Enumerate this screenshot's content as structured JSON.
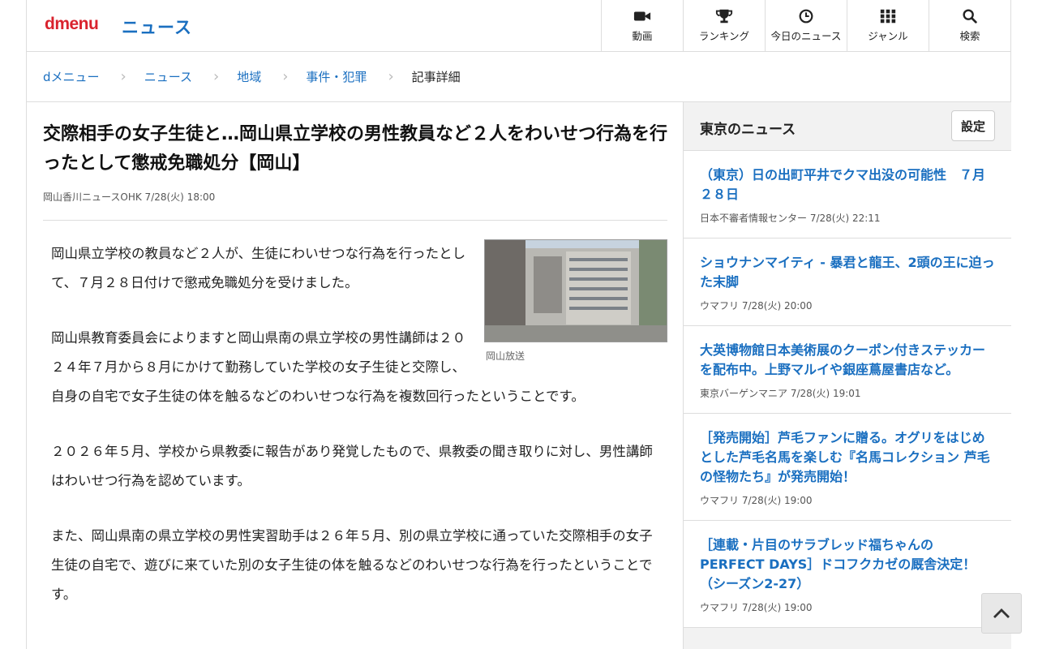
{
  "header": {
    "logo": "dmenu",
    "section": "ニュース",
    "nav": [
      {
        "label": "動画",
        "icon": "video-camera-icon"
      },
      {
        "label": "ランキング",
        "icon": "trophy-icon"
      },
      {
        "label": "今日のニュース",
        "icon": "clock-icon"
      },
      {
        "label": "ジャンル",
        "icon": "grid-icon"
      },
      {
        "label": "検索",
        "icon": "search-icon"
      }
    ]
  },
  "breadcrumb": [
    "dメニュー",
    "ニュース",
    "地域",
    "事件・犯罪",
    "記事詳細"
  ],
  "article": {
    "title": "交際相手の女子生徒と…岡山県立学校の男性教員など２人をわいせつ行為を行ったとして懲戒免職処分【岡山】",
    "meta": "岡山香川ニュースOHK 7/28(火) 18:00",
    "photo_caption": "岡山放送",
    "paragraphs": [
      "岡山県立学校の教員など２人が、生徒にわいせつな行為を行ったとして、７月２８日付けで懲戒免職処分を受けました。",
      "岡山県教育委員会によりますと岡山県南の県立学校の男性講師は２０２４年７月から８月にかけて勤務していた学校の女子生徒と交際し、自身の自宅で女子生徒の体を触るなどのわいせつな行為を複数回行ったということです。",
      "２０２６年５月、学校から県教委に報告があり発覚したもので、県教委の聞き取りに対し、男性講師はわいせつ行為を認めています。",
      "また、岡山県南の県立学校の男性実習助手は２６年５月、別の県立学校に通っていた交際相手の女子生徒の自宅で、遊びに来ていた別の女子生徒の体を触るなどのわいせつな行為を行ったということです。"
    ]
  },
  "sidebar": {
    "title": "東京のニュース",
    "setting_label": "設定",
    "items": [
      {
        "title": "（東京）日の出町平井でクマ出没の可能性　７月２８日",
        "meta": "日本不審者情報センター 7/28(火) 22:11"
      },
      {
        "title": "ショウナンマイティ - 暴君と龍王、2頭の王に迫った末脚",
        "meta": "ウマフリ 7/28(火) 20:00"
      },
      {
        "title": "大英博物館日本美術展のクーポン付きステッカーを配布中。上野マルイや銀座蔦屋書店など。",
        "meta": "東京バーゲンマニア 7/28(火) 19:01"
      },
      {
        "title": "［発売開始］芦毛ファンに贈る。オグリをはじめとした芦毛名馬を楽しむ『名馬コレクション 芦毛の怪物たち』が発売開始！",
        "meta": "ウマフリ 7/28(火) 19:00"
      },
      {
        "title": "［連載・片目のサラブレッド福ちゃんのPERFECT DAYS］ドコフクカゼの厩舎決定！（シーズン2-27）",
        "meta": "ウマフリ 7/28(火) 19:00"
      }
    ]
  },
  "colors": {
    "brand_red": "#d9232e",
    "link_blue": "#1a6fc0"
  }
}
